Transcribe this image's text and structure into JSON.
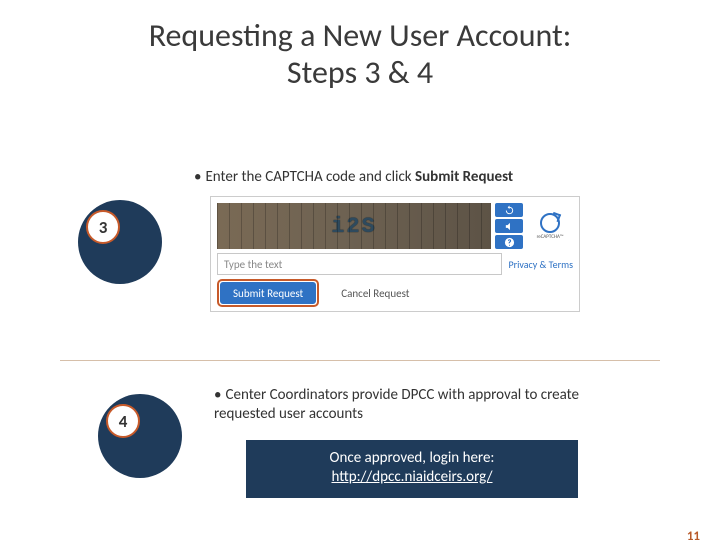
{
  "title_line1": "Requesting a New User Account:",
  "title_line2": "Steps 3 & 4",
  "step3": {
    "number": "3",
    "bullet_prefix": "Enter the CAPTCHA code and click ",
    "bullet_bold": "Submit Request",
    "captcha_text": "i2S",
    "input_placeholder": "Type the text",
    "privacy": "Privacy & Terms",
    "recaptcha_label": "reCAPTCHA™",
    "submit_label": "Submit Request",
    "cancel_label": "Cancel Request"
  },
  "step4": {
    "number": "4",
    "bullet": "Center Coordinators  provide DPCC with approval to create requested user accounts",
    "banner_line1": "Once approved, login here:",
    "banner_url": "http://dpcc.niaidceirs.org/"
  },
  "page_number": "11"
}
